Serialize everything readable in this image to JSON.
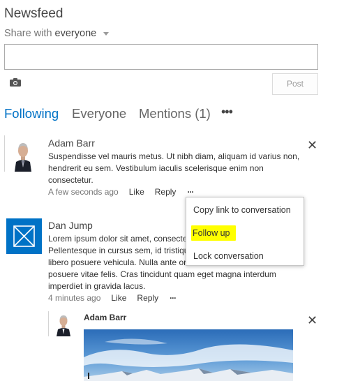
{
  "app": {
    "title": "Newsfeed"
  },
  "share": {
    "prefix": "Share with",
    "audience": "everyone"
  },
  "composer": {
    "post_label": "Post",
    "camera_icon": "camera-icon"
  },
  "tabs": [
    {
      "label": "Following",
      "active": true
    },
    {
      "label": "Everyone",
      "active": false
    },
    {
      "label": "Mentions (1)",
      "active": false
    }
  ],
  "more_label": "•••",
  "posts": [
    {
      "author": "Adam Barr",
      "text": "Suspendisse vel mauris metus. Ut nibh diam, aliquam id varius non, hendrerit eu sem. Vestibulum iaculis scelerisque enim non consectetur.",
      "time": "A few seconds ago",
      "like": "Like",
      "reply": "Reply",
      "more": "···"
    },
    {
      "author": "Dan Jump",
      "lines": [
        "Lorem ipsum dolor sit amet, consecte",
        "Pellentesque in cursus sem, id tristiqu",
        "libero posuere vehicula. Nulla ante or",
        "posuere vitae felis. Cras tincidunt quam eget magna interdum",
        "imperdiet in gravida lacus."
      ],
      "time": "4 minutes ago",
      "like": "Like",
      "reply": "Reply",
      "more": "···"
    },
    {
      "author": "Adam Barr"
    }
  ],
  "context_menu": {
    "items": [
      {
        "label": "Copy link to conversation",
        "highlighted": false
      },
      {
        "label": "Follow up",
        "highlighted": true
      },
      {
        "label": "Lock conversation",
        "highlighted": false
      }
    ]
  },
  "close_glyph": "✕",
  "colors": {
    "accent": "#0072c6",
    "highlight": "#ffff00",
    "placeholder_avatar": "#0072c6"
  }
}
